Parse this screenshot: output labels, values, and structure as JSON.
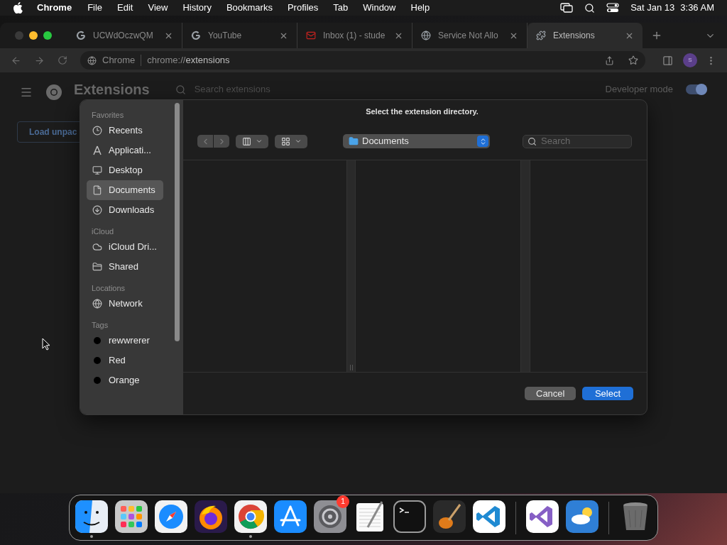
{
  "menubar": {
    "app": "Chrome",
    "menus": [
      "File",
      "Edit",
      "View",
      "History",
      "Bookmarks",
      "Profiles",
      "Tab",
      "Window",
      "Help"
    ],
    "date": "Sat Jan 13",
    "time": "3:36 AM"
  },
  "tabs": [
    {
      "kind": "g",
      "title": "UCWdOczwQM",
      "selected": false
    },
    {
      "kind": "g",
      "title": "YouTube",
      "selected": false
    },
    {
      "kind": "mail",
      "title": "Inbox (1) - stude",
      "selected": false
    },
    {
      "kind": "globe",
      "title": "Service Not Allo",
      "selected": false
    },
    {
      "kind": "puzzle",
      "title": "Extensions",
      "selected": true
    }
  ],
  "toolbar": {
    "site": "Chrome",
    "url_scheme": "chrome://",
    "url_path": "extensions",
    "avatar": "S"
  },
  "extensions": {
    "title": "Extensions",
    "search_placeholder": "Search extensions",
    "developer_mode": {
      "label": "Developer mode",
      "on": true
    },
    "load_button": "Load unpac"
  },
  "dialog": {
    "title": "Select the extension directory.",
    "location": "Documents",
    "search_placeholder": "Search",
    "sidebar": [
      {
        "heading": "Favorites",
        "items": [
          {
            "kind": "clock",
            "label": "Recents",
            "selected": false
          },
          {
            "kind": "apps",
            "label": "Applicati...",
            "selected": false
          },
          {
            "kind": "desktop",
            "label": "Desktop",
            "selected": false
          },
          {
            "kind": "document",
            "label": "Documents",
            "selected": true
          },
          {
            "kind": "download",
            "label": "Downloads",
            "selected": false
          }
        ]
      },
      {
        "heading": "iCloud",
        "items": [
          {
            "kind": "cloud",
            "label": "iCloud Dri...",
            "selected": false
          },
          {
            "kind": "shared",
            "label": "Shared",
            "selected": false
          }
        ]
      },
      {
        "heading": "Locations",
        "items": [
          {
            "kind": "globe",
            "label": "Network",
            "selected": false
          }
        ]
      },
      {
        "heading": "Tags",
        "items": [
          {
            "kind": "tag",
            "label": "rewwrerer",
            "color": "#000000",
            "selected": false
          },
          {
            "kind": "tag",
            "label": "Red",
            "color": "#000000",
            "selected": false
          },
          {
            "kind": "tag",
            "label": "Orange",
            "color": "#000000",
            "selected": false
          }
        ]
      }
    ],
    "buttons": [
      {
        "kind": "secondary",
        "label": "Cancel"
      },
      {
        "kind": "primary",
        "label": "Select"
      }
    ]
  },
  "dock": [
    {
      "kind": "finder",
      "running": true
    },
    {
      "kind": "launchpad",
      "running": false
    },
    {
      "kind": "safari",
      "running": false
    },
    {
      "kind": "firefox",
      "running": false
    },
    {
      "kind": "chrome",
      "running": true
    },
    {
      "kind": "appstore",
      "running": false
    },
    {
      "kind": "settings",
      "running": false,
      "badge": "1"
    },
    {
      "kind": "textedit",
      "running": false
    },
    {
      "kind": "terminal",
      "running": false
    },
    {
      "kind": "garageband",
      "running": false
    },
    {
      "kind": "vscode",
      "running": false
    },
    {
      "kind": "separator"
    },
    {
      "kind": "visualstudio",
      "running": false
    },
    {
      "kind": "weather",
      "running": false
    },
    {
      "kind": "separator"
    },
    {
      "kind": "trash",
      "running": false
    }
  ]
}
